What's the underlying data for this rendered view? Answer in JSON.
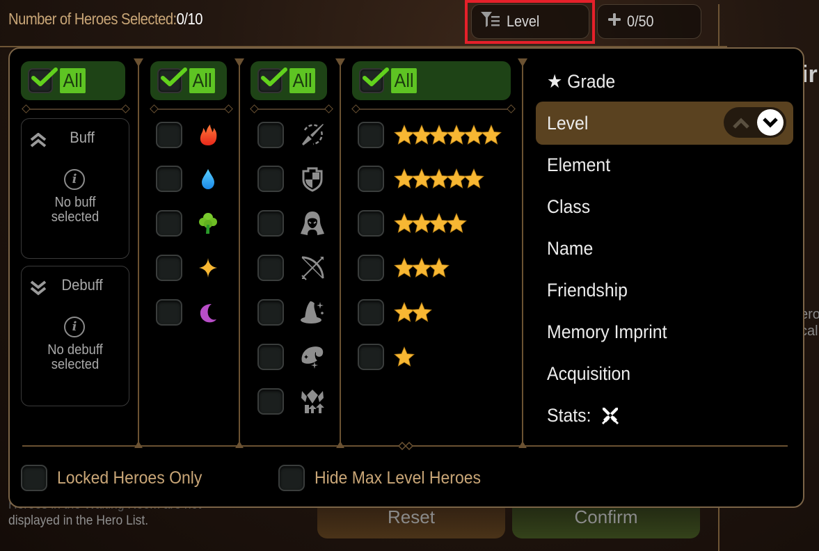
{
  "header": {
    "selected_label": "Number of Heroes Selected:",
    "selected_value": "0/10",
    "sort_button": {
      "label": "Level",
      "icon": "filter-sort-icon",
      "highlighted": true
    },
    "slots_button": {
      "label": "0/50",
      "icon": "plus-icon"
    }
  },
  "background": {
    "hint_line1": "Heroes in the Waiting Room are not",
    "hint_line2": "displayed in the Hero List.",
    "reset_label": "Reset",
    "confirm_label": "Confirm",
    "right_partial_text": "ir",
    "right_partial_lower1": "ero",
    "right_partial_lower2": "cal"
  },
  "filter_panel": {
    "all_label": "All",
    "effects": {
      "buff": {
        "title": "Buff",
        "icon": "double-chevron-up-icon",
        "message_line1": "No buff",
        "message_line2": "selected"
      },
      "debuff": {
        "title": "Debuff",
        "icon": "double-chevron-down-icon",
        "message_line1": "No debuff",
        "message_line2": "selected"
      }
    },
    "elements": [
      {
        "name": "fire",
        "icon": "fire-icon",
        "color": "#f0502a",
        "checked": false
      },
      {
        "name": "water",
        "icon": "water-drop-icon",
        "color": "#2fa8f0",
        "checked": false
      },
      {
        "name": "earth",
        "icon": "tree-icon",
        "color": "#6bc22a",
        "checked": false
      },
      {
        "name": "light",
        "icon": "sparkle-icon",
        "color": "#f5b835",
        "checked": false
      },
      {
        "name": "dark",
        "icon": "moon-icon",
        "color": "#b84ec8",
        "checked": false
      }
    ],
    "classes": [
      {
        "name": "attacker",
        "icon": "sword-icon",
        "checked": false
      },
      {
        "name": "defender",
        "icon": "shield-icon",
        "checked": false
      },
      {
        "name": "assassin",
        "icon": "hooded-figure-icon",
        "checked": false
      },
      {
        "name": "ranger",
        "icon": "bow-icon",
        "checked": false
      },
      {
        "name": "mage",
        "icon": "wizard-hat-icon",
        "checked": false
      },
      {
        "name": "healer",
        "icon": "spirit-icon",
        "checked": false
      },
      {
        "name": "supporter",
        "icon": "buff-arrows-icon",
        "checked": false
      }
    ],
    "grades": [
      {
        "stars": 6,
        "checked": false
      },
      {
        "stars": 5,
        "checked": false
      },
      {
        "stars": 4,
        "checked": false
      },
      {
        "stars": 3,
        "checked": false
      },
      {
        "stars": 2,
        "checked": false
      },
      {
        "stars": 1,
        "checked": false
      }
    ],
    "star_color": "#f7b733",
    "sort_options": [
      {
        "label": "★ Grade",
        "active": false
      },
      {
        "label": "Level",
        "active": true,
        "direction": "descending"
      },
      {
        "label": "Element",
        "active": false
      },
      {
        "label": "Class",
        "active": false
      },
      {
        "label": "Name",
        "active": false
      },
      {
        "label": "Friendship",
        "active": false
      },
      {
        "label": "Memory Imprint",
        "active": false
      },
      {
        "label": "Acquisition",
        "active": false
      },
      {
        "label": "Stats:",
        "active": false,
        "icon": "crossed-swords-icon"
      }
    ],
    "bottom_options": [
      {
        "label": "Locked Heroes Only",
        "checked": false
      },
      {
        "label": "Hide Max Level Heroes",
        "checked": false
      }
    ]
  }
}
